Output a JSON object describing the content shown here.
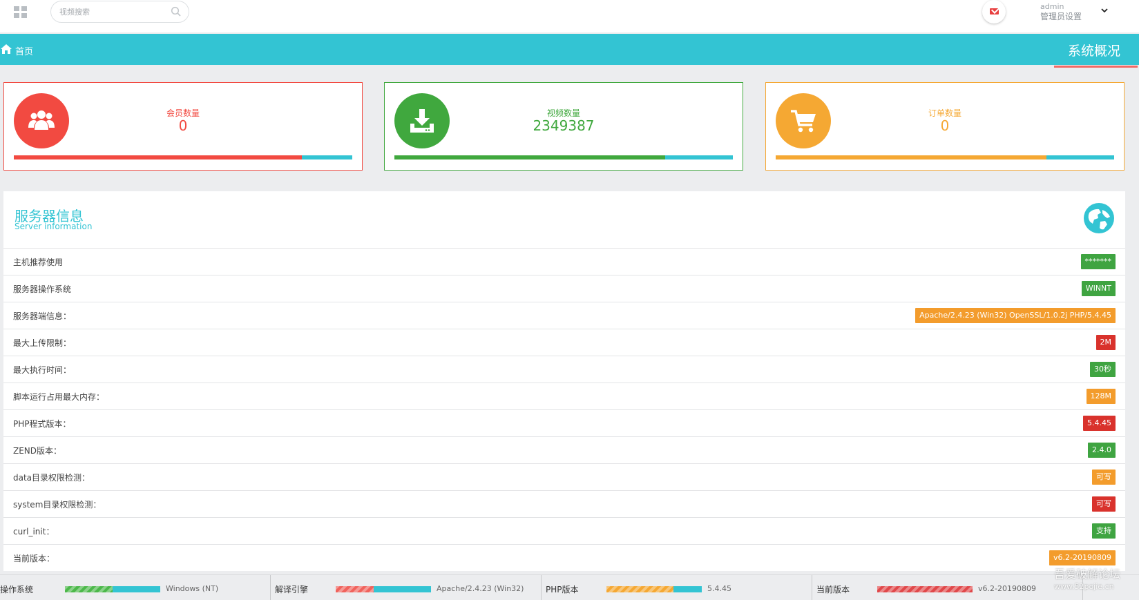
{
  "header": {
    "search_placeholder": "视频搜索",
    "admin_name": "admin",
    "admin_role": "管理员设置"
  },
  "nav": {
    "home": "首页",
    "section": "系统概况"
  },
  "stats": [
    {
      "label": "会员数量",
      "value": "0",
      "color": "#f24a41",
      "progress": 0.85
    },
    {
      "label": "视频数量",
      "value": "2349387",
      "color": "#40a83e",
      "progress": 0.8
    },
    {
      "label": "订单数量",
      "value": "0",
      "color": "#f5a833",
      "progress": 0.8
    }
  ],
  "server": {
    "title": "服务器信息",
    "subtitle": "Server information",
    "rows": [
      {
        "key": "主机推荐使用",
        "value": "*******",
        "color": "#3fa441"
      },
      {
        "key": "服务器操作系统",
        "value": "WINNT",
        "color": "#3fa441"
      },
      {
        "key": "服务器端信息：",
        "value": "Apache/2.4.23 (Win32) OpenSSL/1.0.2j PHP/5.4.45",
        "color": "#f39c2c"
      },
      {
        "key": "最大上传限制：",
        "value": "2M",
        "color": "#d9322c"
      },
      {
        "key": "最大执行时间：",
        "value": "30秒",
        "color": "#3fa441"
      },
      {
        "key": "脚本运行占用最大内存：",
        "value": "128M",
        "color": "#f39c2c"
      },
      {
        "key": "PHP程式版本：",
        "value": "5.4.45",
        "color": "#d9322c"
      },
      {
        "key": "ZEND版本：",
        "value": "2.4.0",
        "color": "#3fa441"
      },
      {
        "key": "data目录权限检测：",
        "value": "可写",
        "color": "#f39c2c"
      },
      {
        "key": "system目录权限检测：",
        "value": "可写",
        "color": "#d9322c"
      },
      {
        "key": "curl_init：",
        "value": "支持",
        "color": "#3fa441"
      },
      {
        "key": "当前版本：",
        "value": "v6.2-20190809",
        "color": "#f39c2c"
      }
    ]
  },
  "footer": [
    {
      "label": "操作系统",
      "value": "Windows (NT)",
      "color": "#4cb84a",
      "progress": 0.5
    },
    {
      "label": "解译引擎",
      "value": "Apache/2.4.23 (Win32)",
      "color": "#f0625c",
      "progress": 0.4
    },
    {
      "label": "PHP版本",
      "value": "5.4.45",
      "color": "#f5a833",
      "progress": 0.7
    },
    {
      "label": "当前版本",
      "value": "v6.2-20190809",
      "color": "#e0484a",
      "progress": 1.0
    }
  ],
  "watermark": {
    "line1": "吾爱破解论坛",
    "line2": "www.52pojie.cn"
  }
}
